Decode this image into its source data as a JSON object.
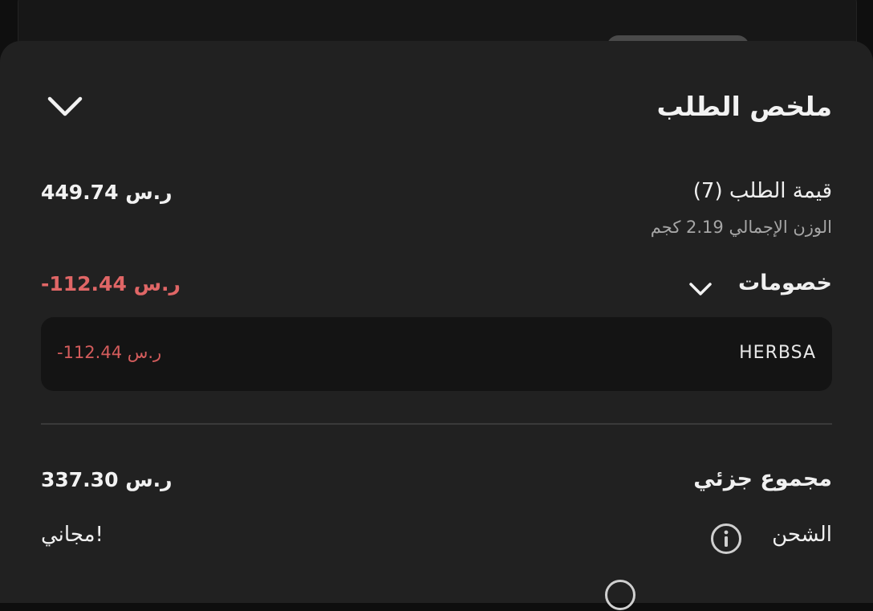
{
  "sheet": {
    "title": "ملخص الطلب"
  },
  "order_value": {
    "label": "قيمة الطلب (7)",
    "weight_label": "الوزن الإجمالي 2.19 كجم",
    "amount": "449.74 ر.س"
  },
  "discounts": {
    "label": "خصومات",
    "amount": "-112.44 ر.س",
    "items": [
      {
        "code": "HERBSA",
        "amount": "-112.44 ر.س"
      }
    ]
  },
  "subtotal": {
    "label": "مجموع جزئي",
    "amount": "337.30 ر.س"
  },
  "shipping": {
    "label": "الشحن",
    "value": "مجاني!"
  },
  "colors": {
    "sheet_background": "#212121",
    "discount_red": "#e06666",
    "text_primary": "#f2f2f2",
    "text_secondary": "#a6a6a6"
  },
  "icons": {
    "collapse": "chevron-down-icon",
    "discounts_toggle": "chevron-down-icon",
    "shipping_info": "info-icon"
  }
}
